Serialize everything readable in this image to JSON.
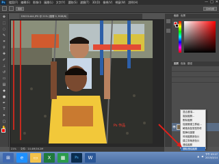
{
  "menubar": {
    "app_logo": "Ps",
    "items": [
      "檔案(F)",
      "編輯(E)",
      "影像(I)",
      "圖層(L)",
      "文字(Y)",
      "選取(S)",
      "濾鏡(T)",
      "3D(D)",
      "檢視(V)",
      "視窗(W)",
      "說明(H)"
    ],
    "window_buttons": [
      "—",
      "□",
      "✕"
    ]
  },
  "optbar": {
    "select_label": "取樣",
    "workspace": "基本功能"
  },
  "document": {
    "tab_title": "DSC01444.JPG @ 21% (圖層 0, RGB/8)",
    "zoom": "21%",
    "doc_info": "文件：14.4M/16.2M",
    "photo_text": "Ps 作品"
  },
  "panels": {
    "color_tabs": [
      "色彩",
      "色票"
    ],
    "layers_tabs": [
      "圖層",
      "色版",
      "路徑"
    ],
    "layer_name": "圖層 0",
    "colors": {
      "foreground": "#e00000",
      "background": "#1a0a0a"
    }
  },
  "context_menu": {
    "items": [
      "混合選項...",
      "複製圖層...",
      "刪除圖層",
      "從圖層建立群組...",
      "轉換為智慧型物件",
      "點陣化圖層",
      "停用圖層遮色片",
      "建立剪裁遮色片",
      "連結圖層",
      "選取連結圖層"
    ],
    "highlighted": 9
  },
  "taskbar": {
    "apps": [
      {
        "name": "start",
        "icon": "⊞",
        "color": "#3f68b0"
      },
      {
        "name": "ie",
        "icon": "e",
        "color": "#1e90ff"
      },
      {
        "name": "explorer",
        "icon": "▭",
        "color": "#f2c24b"
      },
      {
        "name": "excel",
        "icon": "X",
        "color": "#1f7a3c"
      },
      {
        "name": "store",
        "icon": "▦",
        "color": "#2b9b4b"
      },
      {
        "name": "photoshop",
        "icon": "Ps",
        "color": "#0a2c4e"
      },
      {
        "name": "word",
        "icon": "W",
        "color": "#2b5797"
      }
    ],
    "time": "下午 03:27",
    "date": "2015/3/14"
  }
}
